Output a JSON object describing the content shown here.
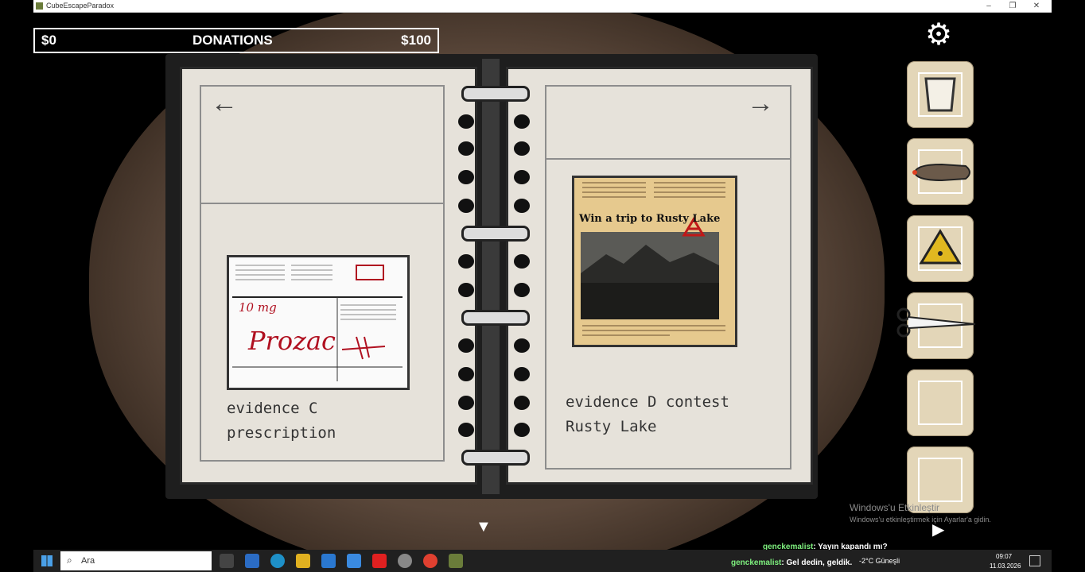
{
  "window": {
    "title": "CubeEscapeParadox",
    "minimize": "–",
    "restore": "❐",
    "close": "✕"
  },
  "donations": {
    "left": "$0",
    "label": "DONATIONS",
    "right": "$100"
  },
  "settings_icon": "gear-icon",
  "inventory": [
    {
      "name": "glass"
    },
    {
      "name": "cigar"
    },
    {
      "name": "triangle-amulet"
    },
    {
      "name": "scissors"
    },
    {
      "name": "empty"
    },
    {
      "name": "empty"
    }
  ],
  "notebook": {
    "left_page": {
      "caption_line1": "evidence C",
      "caption_line2": "prescription",
      "prescription": {
        "dose": "10 mg",
        "drug": "Prozac"
      }
    },
    "right_page": {
      "caption_line1": "evidence D contest",
      "caption_line2": "Rusty Lake",
      "clipping": {
        "headline": "Win a trip to Rusty Lake"
      }
    }
  },
  "down_arrow": "▼",
  "play_icon": "▶",
  "watermark": {
    "line1": "Windows'u Etkinleştir",
    "line2": "Windows'u etkinleştirmek için Ayarlar'a gidin."
  },
  "chat": [
    {
      "user": "genckemalist",
      "text": ": Yayın kapandı mı?"
    },
    {
      "user": "genckemalist",
      "text": ": Gel dedin, geldik."
    }
  ],
  "taskbar": {
    "search_placeholder": "Ara",
    "weather": "-2°C  Güneşli",
    "time": "09:07",
    "date": "11.03.2026"
  },
  "colors": {
    "background": "#000000",
    "vignette": "#5a473a",
    "paper": "#e6e2da",
    "slot": "#e3d6b8"
  }
}
